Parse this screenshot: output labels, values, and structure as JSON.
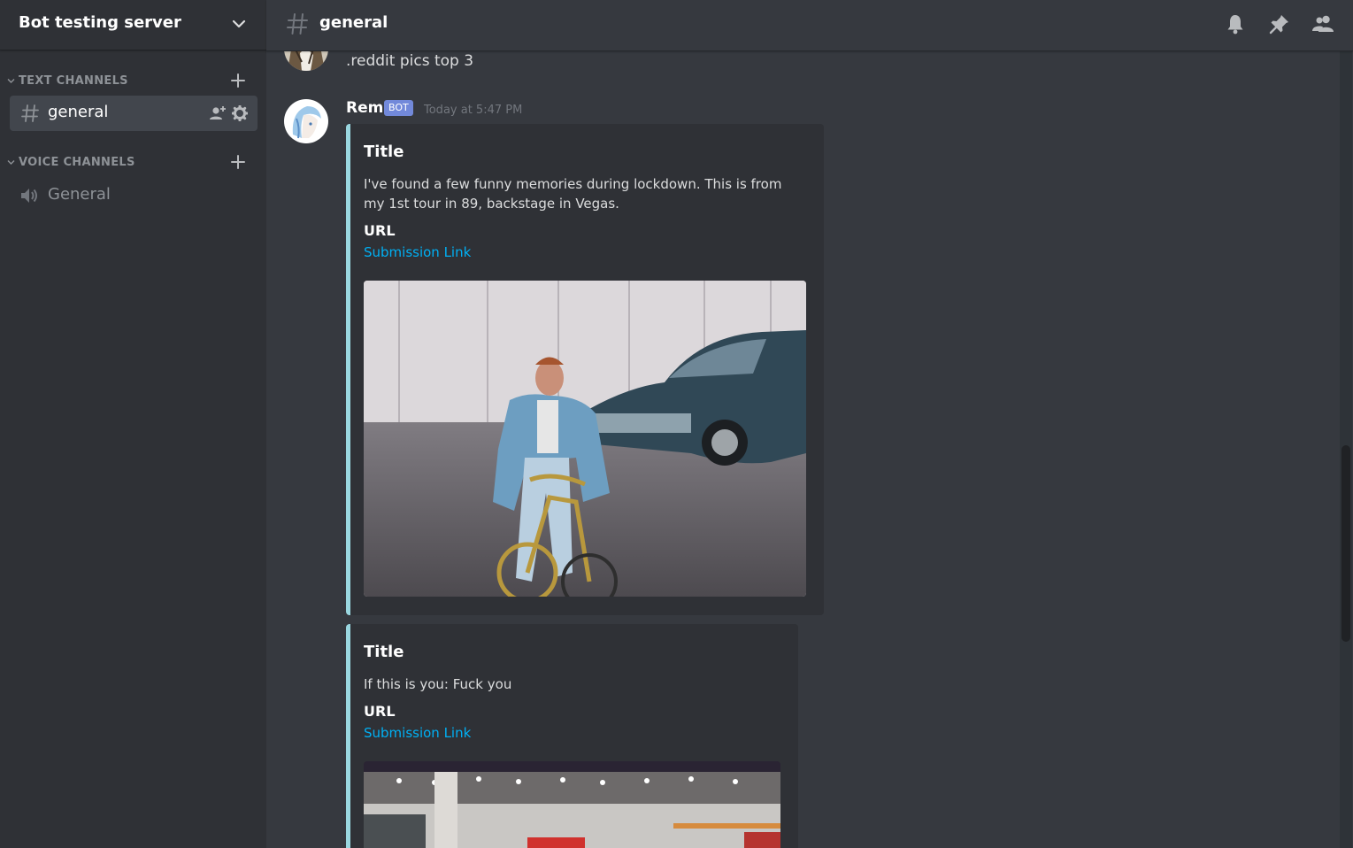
{
  "server": {
    "name": "Bot testing server"
  },
  "sidebar": {
    "text_category": "TEXT CHANNELS",
    "voice_category": "VOICE CHANNELS",
    "text_channels": [
      {
        "label": "general"
      }
    ],
    "voice_channels": [
      {
        "label": "General"
      }
    ]
  },
  "header": {
    "channel": "general"
  },
  "messages": [
    {
      "content": ".reddit pics top 3"
    },
    {
      "author": "Rem",
      "tag": "BOT",
      "timestamp": "Today at 5:47 PM",
      "embeds": [
        {
          "field_name": "Title",
          "field_value": "I've found a few funny memories during lockdown. This is from my 1st tour in 89, backstage in Vegas.",
          "url_name": "URL",
          "link": "Submission Link"
        },
        {
          "field_name": "Title",
          "field_value": "If this is you: Fuck you",
          "url_name": "URL",
          "link": "Submission Link"
        }
      ]
    }
  ],
  "colors": {
    "background": "#36393f",
    "sidebar": "#2f3136",
    "embed_border": "#9ad7e0",
    "link": "#00b0f4",
    "bot_tag": "#7289da"
  },
  "icons": [
    "chevron-down-icon",
    "hash-icon",
    "plus-icon",
    "add-member-icon",
    "gear-icon",
    "speaker-icon",
    "bell-icon",
    "pin-icon",
    "members-icon"
  ]
}
